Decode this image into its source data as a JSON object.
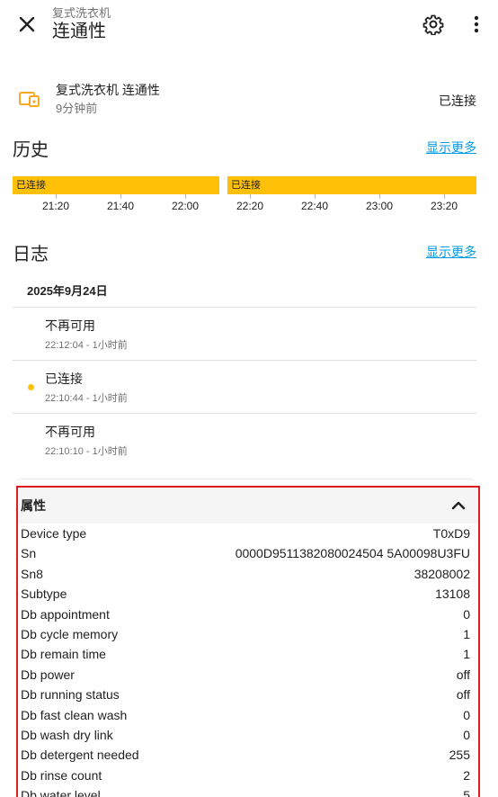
{
  "header": {
    "subtitle": "复式洗衣机",
    "title": "连通性",
    "close_icon": "close-icon",
    "settings_icon": "gear-icon",
    "menu_icon": "more-vert-icon"
  },
  "entity": {
    "icon": "connectivity-icon",
    "name": "复式洗衣机 连通性",
    "last_changed": "9分钟前",
    "state": "已连接"
  },
  "history": {
    "title": "历史",
    "show_more": "显示更多",
    "segments": [
      {
        "label": "已连接",
        "color": "#ffc107"
      },
      {
        "label": "已连接",
        "color": "#ffc107"
      }
    ],
    "ticks": [
      "21:20",
      "21:40",
      "22:00",
      "22:20",
      "22:40",
      "23:00",
      "23:20"
    ]
  },
  "logbook": {
    "title": "日志",
    "show_more": "显示更多",
    "date": "2025年9月24日",
    "entries": [
      {
        "message": "不再可用",
        "time": "22:12:04 - 1小时前",
        "dot": false
      },
      {
        "message": "已连接",
        "time": "22:10:44 - 1小时前",
        "dot": true
      },
      {
        "message": "不再可用",
        "time": "22:10:10 - 1小时前",
        "dot": false
      }
    ]
  },
  "attributes": {
    "title": "属性",
    "rows": [
      {
        "key": "Device type",
        "value": "T0xD9"
      },
      {
        "key": "Sn",
        "value": "0000D9511382080024504 5A00098U3FU"
      },
      {
        "key": "Sn8",
        "value": "38208002"
      },
      {
        "key": "Subtype",
        "value": "13108"
      },
      {
        "key": "Db appointment",
        "value": "0"
      },
      {
        "key": "Db cycle memory",
        "value": "1"
      },
      {
        "key": "Db remain time",
        "value": "1"
      },
      {
        "key": "Db power",
        "value": "off"
      },
      {
        "key": "Db running status",
        "value": "off"
      },
      {
        "key": "Db fast clean wash",
        "value": "0"
      },
      {
        "key": "Db wash dry link",
        "value": "0"
      },
      {
        "key": "Db detergent needed",
        "value": "255"
      },
      {
        "key": "Db rinse count",
        "value": "2"
      },
      {
        "key": "Db water level",
        "value": "5"
      }
    ]
  }
}
